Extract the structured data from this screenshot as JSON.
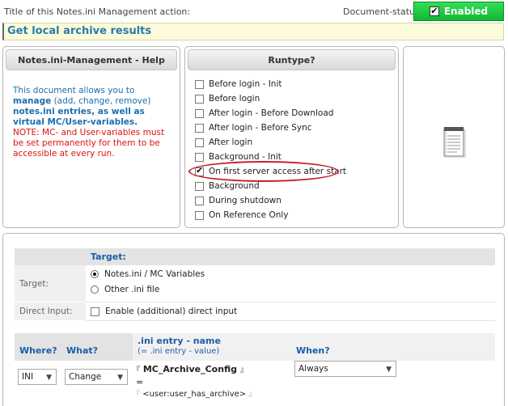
{
  "header": {
    "title_label": "Title of this Notes.ini Management action:",
    "title_value": "Get local archive results",
    "status_label": "Document-status:",
    "status_button": "Enabled",
    "status_color": "#22cc44"
  },
  "help_panel": {
    "heading": "Notes.ini-Management - Help",
    "text_1": "This document allows you to",
    "text_manage": "manage",
    "text_2": "(add, change, remove)",
    "text_entries": "notes.ini entries, as well as virtual MC/User-variables.",
    "note": "NOTE: MC- and User-variables must be set permanently for them to be accessible at every run."
  },
  "runtype_panel": {
    "heading": "Runtype?",
    "options": [
      {
        "label": "Before login - Init",
        "checked": false
      },
      {
        "label": "Before login",
        "checked": false
      },
      {
        "label": "After login - Before Download",
        "checked": false
      },
      {
        "label": "After login - Before Sync",
        "checked": false
      },
      {
        "label": "After login",
        "checked": false
      },
      {
        "label": "Background - Init",
        "checked": false
      },
      {
        "label": "On first server access after start",
        "checked": true
      },
      {
        "label": "Background",
        "checked": false
      },
      {
        "label": "During shutdown",
        "checked": false
      },
      {
        "label": "On Reference Only",
        "checked": false
      }
    ],
    "highlight_color": "#c8202a"
  },
  "icon_panel": {
    "icon": "notepad-icon"
  },
  "target_section": {
    "heading": "Target:",
    "target_label": "Target:",
    "options": [
      {
        "label": "Notes.ini / MC Variables",
        "selected": true
      },
      {
        "label": "Other .ini file",
        "selected": false
      }
    ],
    "direct_input_label": "Direct Input:",
    "direct_input_option": "Enable (additional) direct input",
    "direct_input_checked": false
  },
  "entry_section": {
    "where_header": "Where?",
    "what_header": "What?",
    "entry_header": ".ini entry - name",
    "entry_subheader": "(= .ini entry - value)",
    "when_header": "When?",
    "where_value": "INI",
    "what_value": "Change",
    "entry_name": "MC_Archive_Config",
    "equals": "=",
    "entry_value": "<user:user_has_archive>",
    "when_value": "Always"
  }
}
